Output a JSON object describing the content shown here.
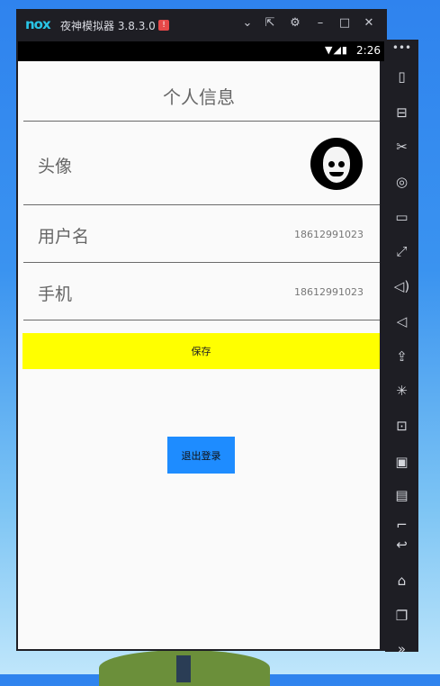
{
  "emulator": {
    "logo": "nox",
    "title": "夜神模拟器 3.8.3.0",
    "badge": "!",
    "titlebar_icons": [
      "chevron-down-icon",
      "pin-icon",
      "gear-icon",
      "minimize-icon",
      "maximize-icon",
      "close-icon"
    ],
    "titlebar_glyphs": [
      "⌄",
      "⇱",
      "⚙",
      "–",
      "□",
      "✕"
    ],
    "sidebar_menu_glyph": "•••",
    "sidebar_icons": [
      {
        "name": "shake-icon",
        "glyph": "▯"
      },
      {
        "name": "robot-icon",
        "glyph": "⊟"
      },
      {
        "name": "scissors-icon",
        "glyph": "✂"
      },
      {
        "name": "location-icon",
        "glyph": "◎"
      },
      {
        "name": "screen-icon",
        "glyph": "▭"
      },
      {
        "name": "fullscreen-icon",
        "glyph": "⤢"
      },
      {
        "name": "volume-up-icon",
        "glyph": "◁)"
      },
      {
        "name": "volume-down-icon",
        "glyph": "◁"
      },
      {
        "name": "apk-install-icon",
        "glyph": "⇪"
      },
      {
        "name": "loading-icon",
        "glyph": "✳"
      },
      {
        "name": "virtual-key-icon",
        "glyph": "⊡"
      },
      {
        "name": "video-record-icon",
        "glyph": "▣"
      },
      {
        "name": "multi-instance-icon",
        "glyph": "▤"
      },
      {
        "name": "more-icon",
        "glyph": "⌐"
      },
      {
        "name": "back-icon",
        "glyph": "↩"
      },
      {
        "name": "home-icon",
        "glyph": "⌂"
      },
      {
        "name": "recent-apps-icon",
        "glyph": "❐"
      },
      {
        "name": "expand-icon",
        "glyph": "»"
      }
    ]
  },
  "status_bar": {
    "time": "2:26",
    "icons": "▼◢▮"
  },
  "app": {
    "page_title": "个人信息",
    "avatar_label": "头像",
    "username_label": "用户名",
    "username_value": "18612991023",
    "phone_label": "手机",
    "phone_value": "18612991023",
    "save_button": "保存",
    "logout_button": "退出登录"
  },
  "colors": {
    "save_button_bg": "#ffff00",
    "logout_button_bg": "#1e8cff"
  }
}
